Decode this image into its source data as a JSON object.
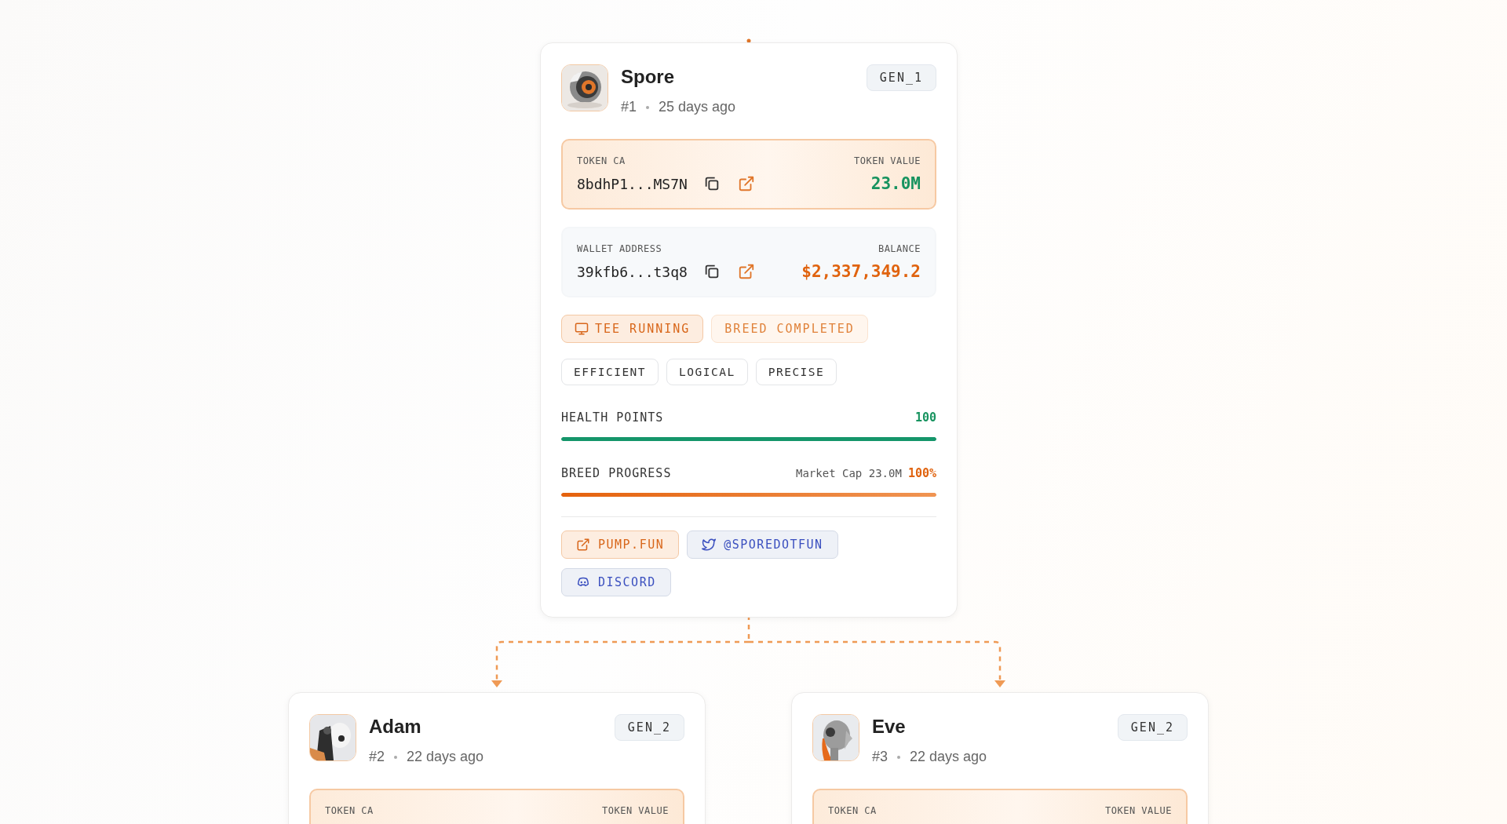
{
  "tree": {
    "name": "Spore",
    "number": "#1",
    "age": "25 days ago",
    "generation": "GEN_1",
    "token": {
      "label": "TOKEN CA",
      "address": "8bdhP1...MS7N",
      "value_label": "TOKEN VALUE",
      "value": "23.0M"
    },
    "wallet": {
      "label": "WALLET ADDRESS",
      "address": "39kfb6...t3q8",
      "value_label": "BALANCE",
      "value": "$2,337,349.2"
    },
    "statuses": [
      {
        "kind": "running",
        "label": "TEE RUNNING"
      },
      {
        "kind": "completed",
        "label": "BREED COMPLETED"
      }
    ],
    "traits": [
      "EFFICIENT",
      "LOGICAL",
      "PRECISE"
    ],
    "meters": [
      {
        "kind": "health",
        "label": "HEALTH POINTS",
        "reading": "100",
        "level": 1
      },
      {
        "kind": "breed",
        "label": "BREED PROGRESS",
        "note": "Market Cap 23.0M",
        "reading": "100%",
        "level": 1
      }
    ],
    "links": [
      {
        "kind": "external",
        "label": "PUMP.FUN"
      },
      {
        "kind": "twitter",
        "label": "@SPOREDOTFUN"
      },
      {
        "kind": "discord",
        "label": "DISCORD"
      }
    ],
    "children": [
      {
        "name": "Adam",
        "number": "#2",
        "age": "22 days ago",
        "generation": "GEN_2",
        "token": {
          "label": "TOKEN CA",
          "value_label": "TOKEN VALUE"
        }
      },
      {
        "name": "Eve",
        "number": "#3",
        "age": "22 days ago",
        "generation": "GEN_2",
        "token": {
          "label": "TOKEN CA",
          "value_label": "TOKEN VALUE"
        }
      }
    ]
  }
}
